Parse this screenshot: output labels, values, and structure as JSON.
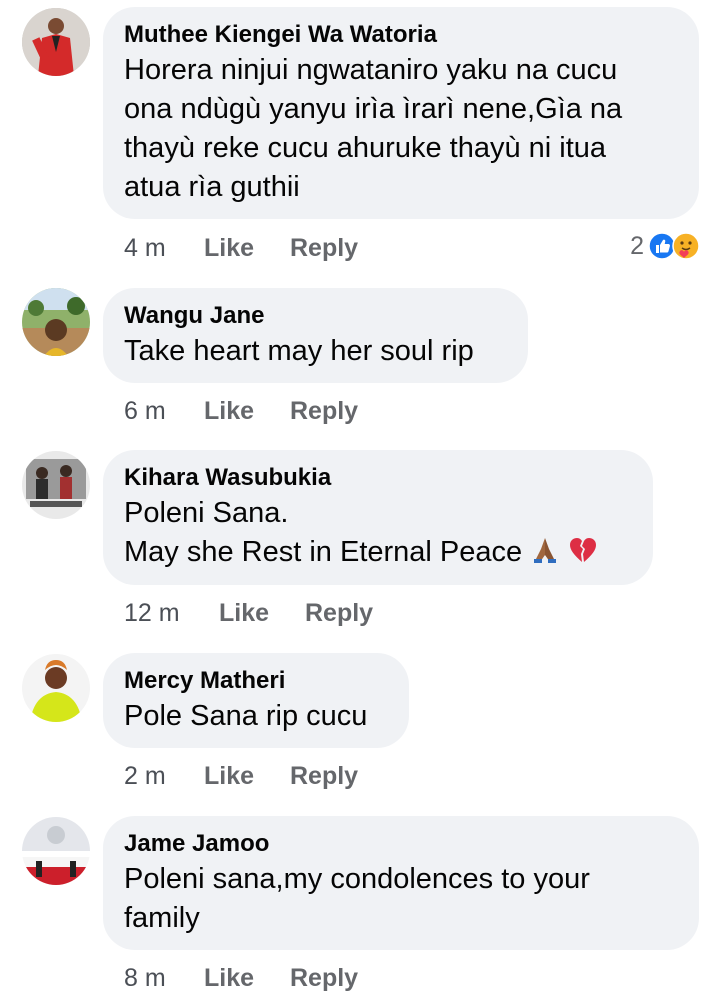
{
  "comments": [
    {
      "author": "Muthee Kiengei Wa Watoria",
      "text_lines": [
        "Horera ninjui ngwataniro yaku na cucu",
        "ona ndùgù yanyu irìa ìrarì nene,Gìa na",
        "thayù reke cucu ahuruke thayù ni itua",
        "atua rìa guthii"
      ],
      "time": "4 m",
      "like_label": "Like",
      "reply_label": "Reply",
      "reaction_count": "2",
      "reaction_icons": [
        "like-icon",
        "care-icon"
      ]
    },
    {
      "author": "Wangu Jane",
      "text_lines": [
        "Take heart may her soul rip"
      ],
      "time": "6 m",
      "like_label": "Like",
      "reply_label": "Reply"
    },
    {
      "author": "Kihara Wasubukia",
      "text_lines": [
        "Poleni Sana.",
        "May she Rest in Eternal Peace"
      ],
      "emojis": [
        "praying-hands-icon",
        "broken-heart-icon"
      ],
      "time": "12 m",
      "like_label": "Like",
      "reply_label": "Reply"
    },
    {
      "author": "Mercy Matheri",
      "text_lines": [
        "Pole Sana rip cucu"
      ],
      "time": "2 m",
      "like_label": "Like",
      "reply_label": "Reply"
    },
    {
      "author": "Jame Jamoo",
      "text_lines": [
        "Poleni sana,my condolences to your",
        "family"
      ],
      "time": "8 m",
      "like_label": "Like",
      "reply_label": "Reply"
    }
  ],
  "colors": {
    "bubble_bg": "#f0f2f5",
    "meta_text": "#65676b",
    "like_blue": "#1877f2"
  }
}
